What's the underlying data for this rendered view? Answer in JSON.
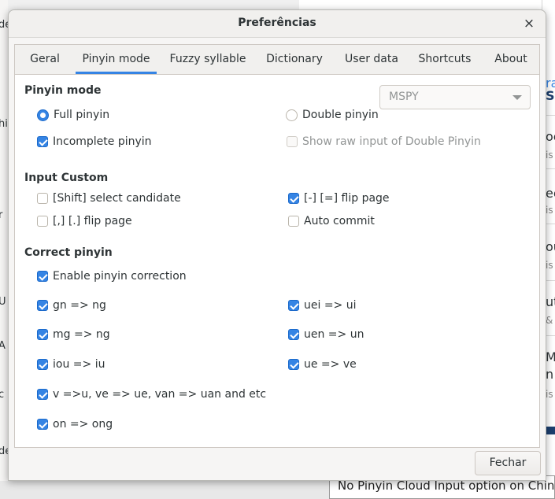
{
  "window": {
    "title": "Preferências",
    "close_symbol": "×"
  },
  "tabs": [
    {
      "label": "Geral"
    },
    {
      "label": "Pinyin mode"
    },
    {
      "label": "Fuzzy syllable"
    },
    {
      "label": "Dictionary"
    },
    {
      "label": "User data"
    },
    {
      "label": "Shortcuts"
    },
    {
      "label": "About"
    }
  ],
  "active_tab": "Pinyin mode",
  "pinyin_mode": {
    "title": "Pinyin mode",
    "full_pinyin": {
      "label": "Full pinyin",
      "selected": true
    },
    "double_pinyin": {
      "label": "Double pinyin",
      "selected": false
    },
    "double_scheme": {
      "value": "MSPY",
      "enabled": false
    },
    "incomplete_pinyin": {
      "label": "Incomplete pinyin",
      "checked": true
    },
    "show_raw": {
      "label": "Show raw input of Double Pinyin",
      "checked": false,
      "enabled": false
    }
  },
  "input_custom": {
    "title": "Input Custom",
    "shift_select": {
      "label": "[Shift] select candidate",
      "checked": false
    },
    "minus_equal_flip": {
      "label": "[-] [=] flip page",
      "checked": true
    },
    "comma_period_flip": {
      "label": "[,] [.] flip page",
      "checked": false
    },
    "auto_commit": {
      "label": "Auto commit",
      "checked": false
    }
  },
  "correct_pinyin": {
    "title": "Correct pinyin",
    "enable": {
      "label": "Enable pinyin correction",
      "checked": true
    },
    "gn_ng": {
      "label": "gn => ng",
      "checked": true
    },
    "uei_ui": {
      "label": "uei => ui",
      "checked": true
    },
    "mg_ng": {
      "label": "mg => ng",
      "checked": true
    },
    "uen_un": {
      "label": "uen => un",
      "checked": true
    },
    "iou_iu": {
      "label": "iou => iu",
      "checked": true
    },
    "ue_ve": {
      "label": "ue => ve",
      "checked": true
    },
    "v_u": {
      "label": "v =>u, ve => ue, van => uan and etc",
      "checked": true
    },
    "on_ong": {
      "label": "on => ong",
      "checked": true
    }
  },
  "footer": {
    "close_label": "Fechar"
  },
  "background": {
    "left_fragments": [
      "de",
      "hi",
      "r",
      "U",
      "A",
      "c",
      "de"
    ],
    "right_fragments": [
      "ra",
      "S(",
      "oc",
      "is",
      "ec",
      "is",
      "ou",
      "is",
      "ut",
      "& F",
      "M",
      "n",
      "is"
    ],
    "bottom_text": "No Pinyin Cloud Input option on Chines"
  },
  "colors": {
    "accent": "#3584e4",
    "dialog_bg": "#f6f5f4",
    "content_bg": "#ffffff",
    "text": "#2e3436",
    "disabled_text": "#929595"
  }
}
